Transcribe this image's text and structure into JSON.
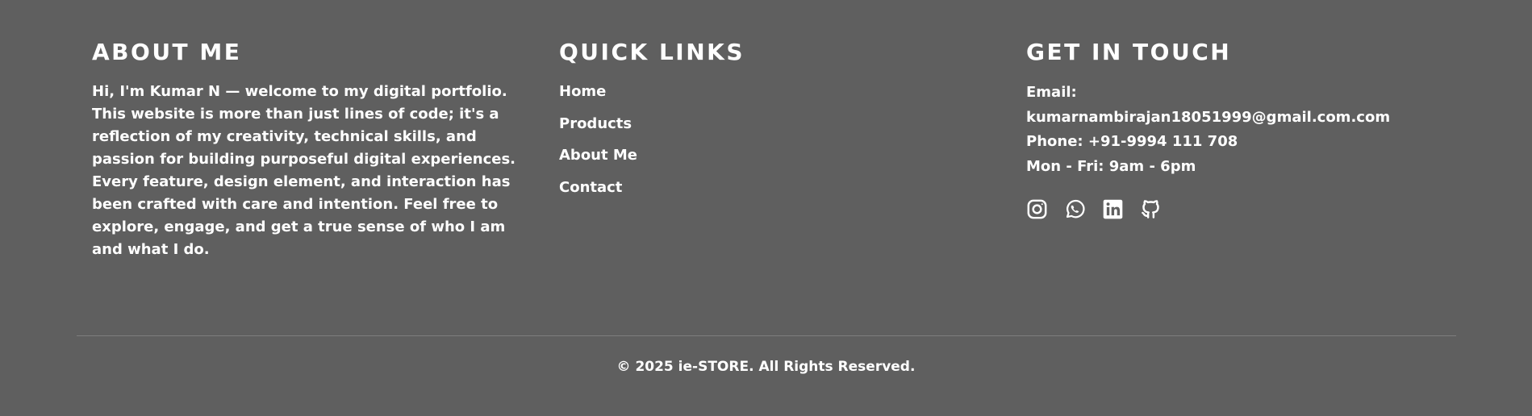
{
  "about": {
    "title": "ABOUT ME",
    "text": "Hi, I'm Kumar N — welcome to my digital portfolio. This website is more than just lines of code; it's a reflection of my creativity, technical skills, and passion for building purposeful digital experiences. Every feature, design element, and interaction has been crafted with care and intention. Feel free to explore, engage, and get a true sense of who I am and what I do."
  },
  "quick_links": {
    "title": "QUICK LINKS",
    "items": [
      {
        "label": "Home"
      },
      {
        "label": "Products"
      },
      {
        "label": "About Me"
      },
      {
        "label": "Contact"
      }
    ]
  },
  "contact": {
    "title": "GET IN TOUCH",
    "email_label": "Email:",
    "email_value": "kumarnambirajan18051999@gmail.com.com",
    "phone": "Phone: +91-9994 111 708",
    "hours": "Mon - Fri: 9am - 6pm",
    "social": [
      {
        "icon": "instagram-icon"
      },
      {
        "icon": "whatsapp-icon"
      },
      {
        "icon": "linkedin-icon"
      },
      {
        "icon": "github-icon"
      }
    ]
  },
  "footer": {
    "copyright": "© 2025 ie-STORE. All Rights Reserved."
  },
  "colors": {
    "background": "#5f5f5f",
    "text": "#ffffff",
    "divider": "#7d7d7d"
  }
}
